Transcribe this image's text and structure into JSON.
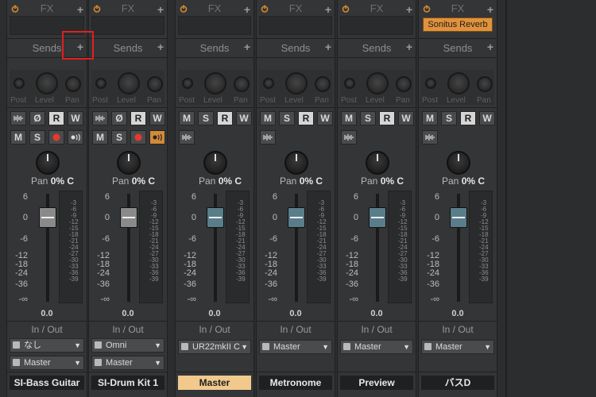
{
  "labels": {
    "fx": "FX",
    "sends": "Sends",
    "post": "Post",
    "level": "Level",
    "pan": "Pan",
    "pan_value": "0%",
    "pan_c": "C",
    "in_out": "In / Out",
    "add": "+",
    "m": "M",
    "s": "S",
    "r": "R",
    "w": "W",
    "mute_icon": "Ø"
  },
  "scale": [
    "6",
    "0",
    "-6",
    "-12",
    "-18",
    "-24",
    "-36",
    "-∞"
  ],
  "meter_ticks": [
    "-3",
    "-6",
    "-9",
    "-12",
    "-15",
    "-18",
    "-21",
    "-24",
    "-27",
    "-30",
    "-33",
    "-36",
    "-39"
  ],
  "channels": [
    {
      "name": "SI-Bass Guitar",
      "volume": "0.0",
      "input": "なし",
      "output": "Master",
      "fx_slot": "",
      "cap_color": "#8a8a8a"
    },
    {
      "name": "SI-Drum Kit 1",
      "volume": "0.0",
      "input": "Omni",
      "output": "Master",
      "fx_slot": "",
      "cap_color": "#8a8a8a"
    },
    {
      "name": "Master",
      "volume": "0.0",
      "input": "UR22mkII C",
      "output": "",
      "fx_slot": "",
      "cap_color": "#5a7d8a"
    },
    {
      "name": "Metronome",
      "volume": "0.0",
      "input": "Master",
      "output": "",
      "fx_slot": "",
      "cap_color": "#5a7d8a"
    },
    {
      "name": "Preview",
      "volume": "0.0",
      "input": "Master",
      "output": "",
      "fx_slot": "",
      "cap_color": "#5a7d8a"
    },
    {
      "name": "バスD",
      "volume": "0.0",
      "input": "Master",
      "output": "",
      "fx_slot": "Sonitus Reverb",
      "cap_color": "#5a7d8a"
    }
  ]
}
